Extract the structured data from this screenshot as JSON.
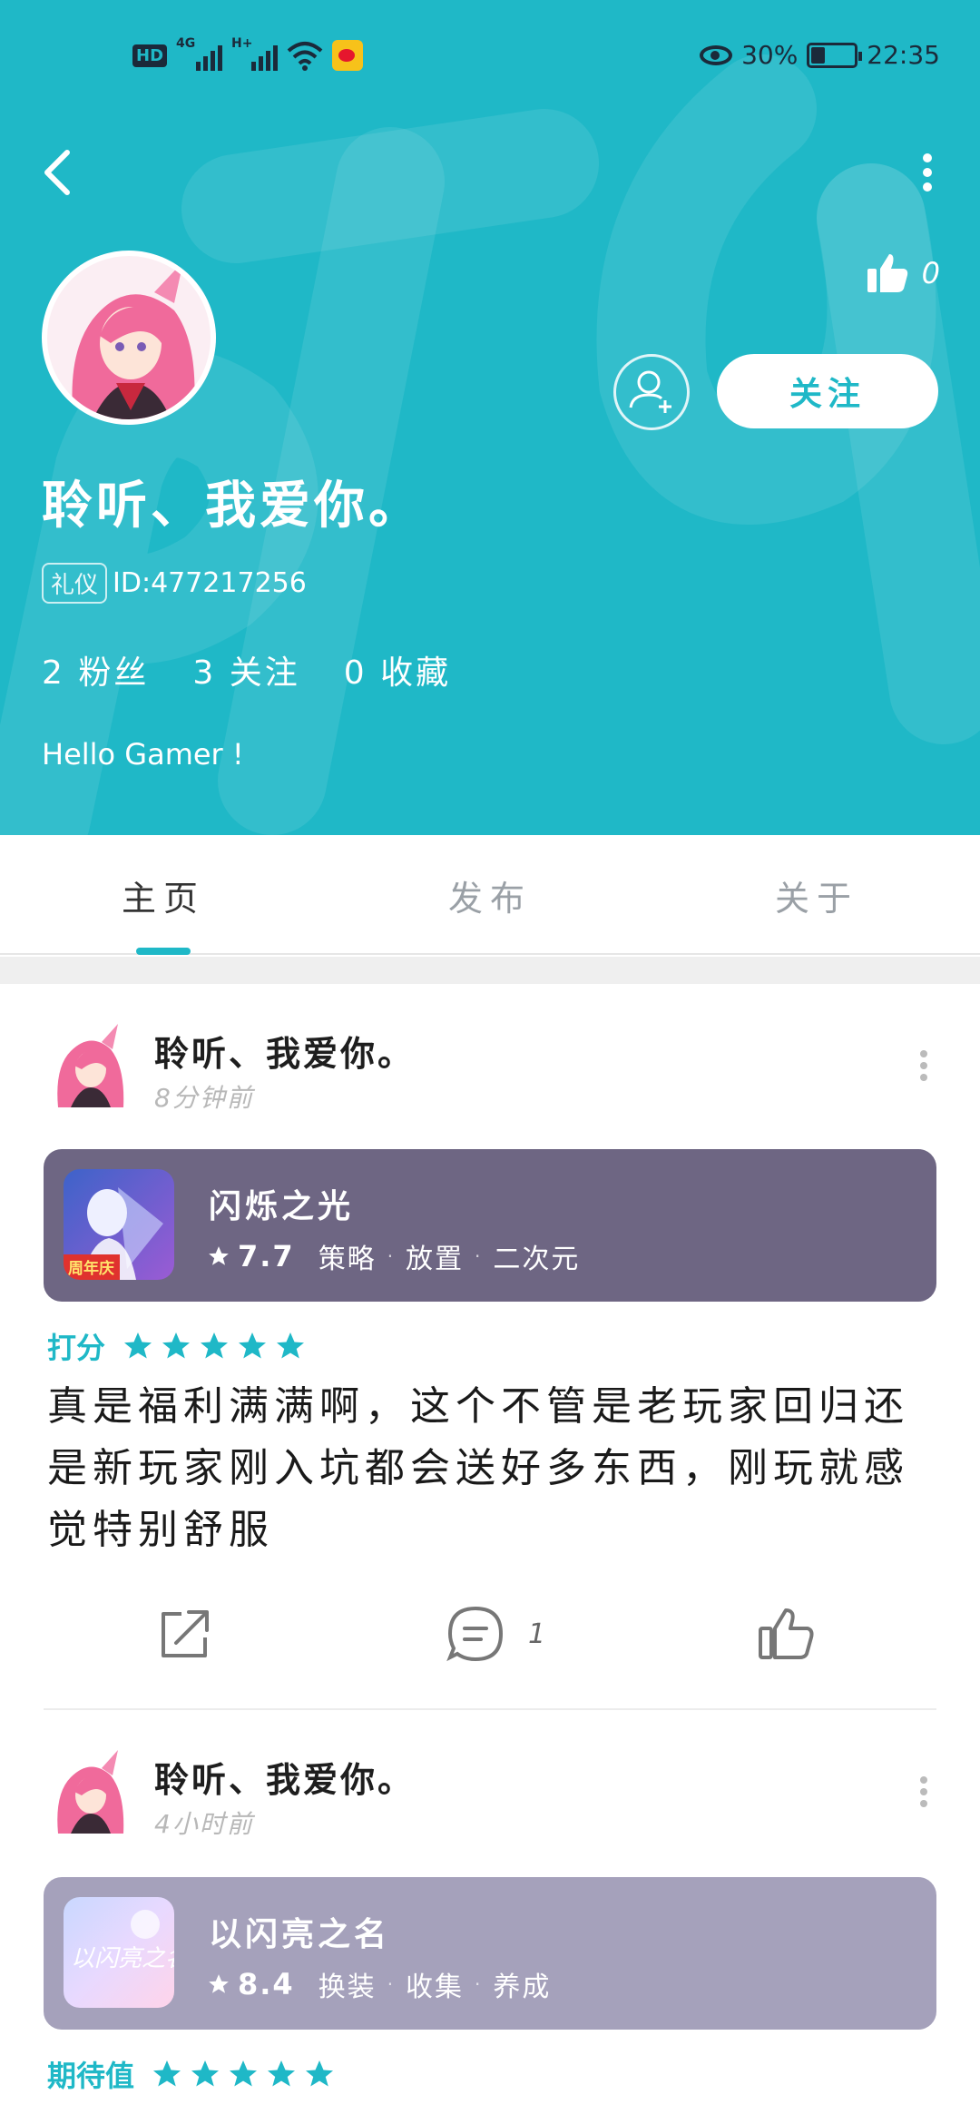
{
  "status_bar": {
    "hd": "HD",
    "network1": "4G",
    "network2": "H+",
    "eye_icon": "eye-comfort-icon",
    "battery": "30%",
    "battery_level": 0.3,
    "time": "22:35"
  },
  "colors": {
    "brand": "#1fb8c7",
    "card1": "#6e6683",
    "card2": "#a5a1bb",
    "star": "#1fb8c7"
  },
  "profile": {
    "like_count": "0",
    "follow_button": "关注",
    "username": "聆听、我爱你。",
    "badge": "礼仪",
    "id_text": "ID:477217256",
    "stats": [
      {
        "value": "2",
        "label": "粉丝"
      },
      {
        "value": "3",
        "label": "关注"
      },
      {
        "value": "0",
        "label": "收藏"
      }
    ],
    "bio": "Hello Gamer !"
  },
  "tabs": [
    {
      "label": "主页",
      "active": true
    },
    {
      "label": "发布",
      "active": false
    },
    {
      "label": "关于",
      "active": false
    }
  ],
  "posts": [
    {
      "author": "聆听、我爱你。",
      "time": "8分钟前",
      "game": {
        "name": "闪烁之光",
        "score": "7.7",
        "tags": [
          "策略",
          "放置",
          "二次元"
        ],
        "icon_badge": "周年庆"
      },
      "rating_label": "打分",
      "stars": 5,
      "text": "真是福利满满啊，这个不管是老玩家回归还是新玩家刚入坑都会送好多东西，刚玩就感觉特别舒服",
      "comment_count": "1"
    },
    {
      "author": "聆听、我爱你。",
      "time": "4小时前",
      "game": {
        "name": "以闪亮之名",
        "score": "8.4",
        "tags": [
          "换装",
          "收集",
          "养成"
        ],
        "icon_text": "以闪亮之名"
      },
      "rating_label": "期待值",
      "stars": 5
    }
  ]
}
